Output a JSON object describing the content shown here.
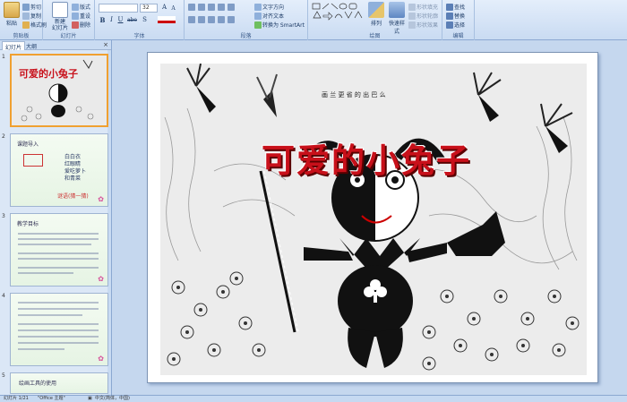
{
  "ribbon": {
    "clipboard": {
      "label": "剪贴板",
      "paste": "粘贴",
      "cut": "剪切",
      "copy": "复制",
      "format_painter": "格式刷"
    },
    "slides": {
      "label": "幻灯片",
      "new_slide": "新建\n幻灯片",
      "layout": "版式",
      "reset": "重设",
      "delete": "删除"
    },
    "font": {
      "label": "字体",
      "font_size": "32",
      "grow": "A",
      "shrink": "A",
      "bold": "B",
      "italic": "I",
      "underline": "U",
      "strike": "abe",
      "shadow": "S"
    },
    "paragraph": {
      "label": "段落",
      "text_direction": "文字方向",
      "align_text": "对齐文本",
      "smartart": "转换为 SmartArt"
    },
    "drawing": {
      "label": "绘图",
      "arrange": "排列",
      "quick_styles": "快速样式",
      "shape_fill": "形状填充",
      "shape_outline": "形状轮廓",
      "shape_effects": "形状效果"
    },
    "editing": {
      "label": "编辑",
      "find": "查找",
      "replace": "替换",
      "select": "选择"
    }
  },
  "left_panel": {
    "tabs": [
      "幻灯片",
      "大纲"
    ],
    "close": "×",
    "slides": [
      {
        "number": "1",
        "title": "可爱的小兔子",
        "lines": []
      },
      {
        "number": "2",
        "title": "课题导入",
        "lines": [
          "白白衣",
          "红眼睛",
          "爱吃萝卜",
          "和青菜",
          "谜语(猜一猜)"
        ]
      },
      {
        "number": "3",
        "title": "教学目标",
        "lines": []
      },
      {
        "number": "4",
        "title": "",
        "lines": []
      },
      {
        "number": "5",
        "title": "绘画工具的使用",
        "lines": []
      }
    ]
  },
  "slide": {
    "title": "可爱的小兔子",
    "note": "画 兰 更 省 的 出 巴 么"
  },
  "status": {
    "slide_counter": "幻灯片 1/21",
    "theme": "\"Office 主题\"",
    "language": "中文(简体，中国)"
  },
  "colors": {
    "accent": "#c8101a",
    "ribbon": "#dbe6f5",
    "panel": "#c5d7ee"
  }
}
